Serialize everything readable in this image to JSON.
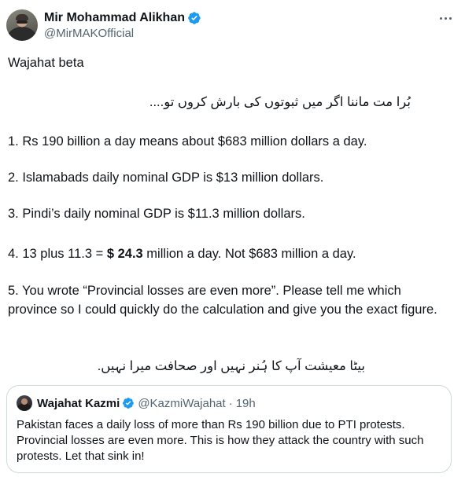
{
  "author": {
    "display_name": "Mir Mohammad Alikhan",
    "handle": "@MirMAKOfficial"
  },
  "tweet": {
    "line1": "Wajahat beta",
    "line2_urdu": "بُرا مت ماننا اگر میں ثبوتوں کی بارش کروں تو....",
    "point1": "1. Rs 190 billion a day means about $683 million dollars a day.",
    "point2": "2. Islamabads daily nominal GDP is $13 million dollars.",
    "point3": "3. Pindi’s daily nominal GDP is $11.3 million dollars.",
    "point4_prefix": "4. 13 plus 11.3 = ",
    "point4_bold": "$ 24.3",
    "point4_suffix": " million a day. Not $683 million a day.",
    "point5": "5. You wrote “Provincial losses are even more”. Please tell me which province so I could quickly do the calculation and give you the exact figure.",
    "closing_urdu": "بیٹا معیشت آپ کا ہُنر نہیں اور صحافت میرا نہیں."
  },
  "quoted": {
    "display_name": "Wajahat Kazmi",
    "handle": "@KazmiWajahat",
    "separator": "·",
    "time": "19h",
    "text": "Pakistan faces a daily loss of more than Rs 190 billion due to PTI protests. Provincial losses are even more. This is how they attack the country with such protests. Let that sink in!"
  },
  "colors": {
    "verified": "#1d9bf0",
    "secondary_text": "#536471",
    "border": "#cfd9de"
  }
}
